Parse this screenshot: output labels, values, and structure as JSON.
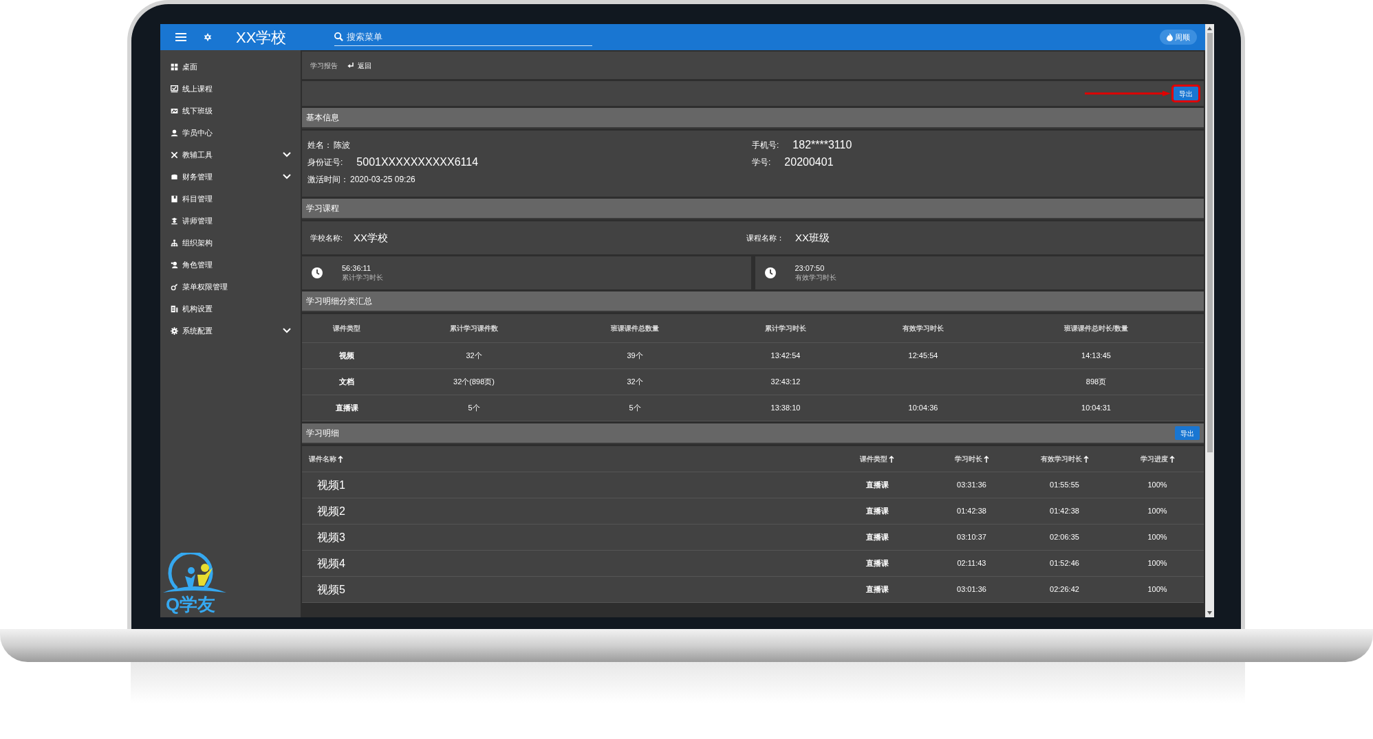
{
  "topbar": {
    "title": "XX学校",
    "search": {
      "placeholder": "搜索菜单"
    },
    "user": "周顺"
  },
  "sidebar": {
    "items": [
      {
        "label": "桌面",
        "expandable": false
      },
      {
        "label": "线上课程",
        "expandable": false
      },
      {
        "label": "线下班级",
        "expandable": false
      },
      {
        "label": "学员中心",
        "expandable": false
      },
      {
        "label": "教辅工具",
        "expandable": true
      },
      {
        "label": "财务管理",
        "expandable": true
      },
      {
        "label": "科目管理",
        "expandable": false
      },
      {
        "label": "讲师管理",
        "expandable": false
      },
      {
        "label": "组织架构",
        "expandable": false
      },
      {
        "label": "角色管理",
        "expandable": false
      },
      {
        "label": "菜单权限管理",
        "expandable": false
      },
      {
        "label": "机构设置",
        "expandable": false
      },
      {
        "label": "系统配置",
        "expandable": true
      }
    ],
    "logo_text": "Q学友"
  },
  "breadcrumb": {
    "current": "学习报告",
    "back": "返回"
  },
  "toolbar": {
    "export_button": "导出",
    "highlighted": true
  },
  "basic_info": {
    "title": "基本信息",
    "left": [
      {
        "label": "姓名：",
        "value": "陈波",
        "large": false
      },
      {
        "label": "身份证号:",
        "value": "5001XXXXXXXXXX6114",
        "large": true
      },
      {
        "label": "激活时间：",
        "value": "2020-03-25 09:26",
        "large": false
      }
    ],
    "right": [
      {
        "label": "手机号:",
        "value": "182****3110",
        "large": true
      },
      {
        "label": "学号:",
        "value": "20200401",
        "large": true
      }
    ]
  },
  "course": {
    "title": "学习课程",
    "fields": [
      {
        "label": "学校名称:",
        "value": "XX学校"
      },
      {
        "label": "课程名称：",
        "value": "XX班级"
      }
    ],
    "stats": [
      {
        "value": "56:36:11",
        "label": "累计学习时长"
      },
      {
        "value": "23:07:50",
        "label": "有效学习时长"
      }
    ]
  },
  "summary": {
    "title": "学习明细分类汇总",
    "columns": [
      "课件类型",
      "累计学习课件数",
      "班课课件总数量",
      "累计学习时长",
      "有效学习时长",
      "班课课件总时长/数量"
    ],
    "rows": [
      [
        "视频",
        "32个",
        "39个",
        "13:42:54",
        "12:45:54",
        "14:13:45"
      ],
      [
        "文档",
        "32个(898页)",
        "32个",
        "32:43:12",
        "",
        "898页"
      ],
      [
        "直播课",
        "5个",
        "5个",
        "13:38:10",
        "10:04:36",
        "10:04:31"
      ]
    ]
  },
  "detail": {
    "title": "学习明细",
    "export_button": "导出",
    "columns": [
      "课件名称",
      "课件类型",
      "学习时长",
      "有效学习时长",
      "学习进度"
    ],
    "rows": [
      [
        "视频1",
        "直播课",
        "03:31:36",
        "01:55:55",
        "100%"
      ],
      [
        "视频2",
        "直播课",
        "01:42:38",
        "01:42:38",
        "100%"
      ],
      [
        "视频3",
        "直播课",
        "03:10:37",
        "02:06:35",
        "100%"
      ],
      [
        "视频4",
        "直播课",
        "02:11:43",
        "01:52:46",
        "100%"
      ],
      [
        "视频5",
        "直播课",
        "03:01:36",
        "02:26:42",
        "100%"
      ]
    ]
  }
}
